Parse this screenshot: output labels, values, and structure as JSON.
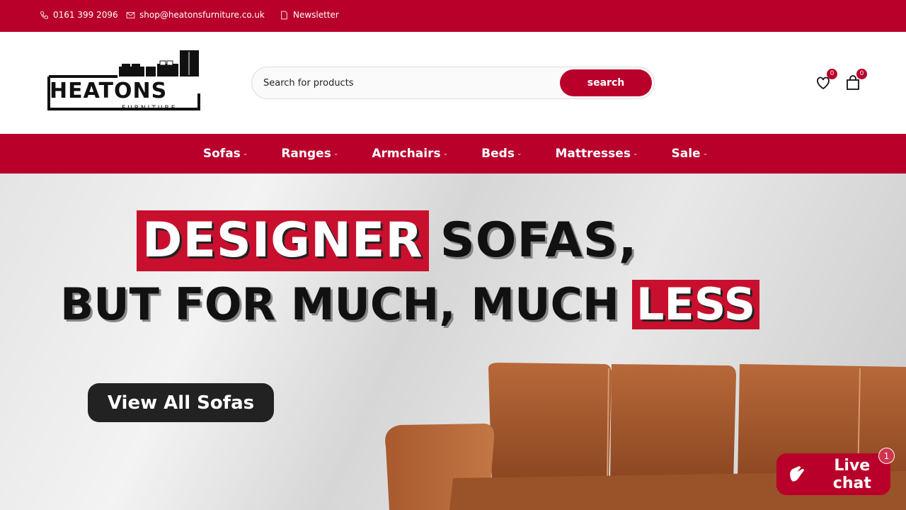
{
  "topbar": {
    "phone": "0161 399 2096",
    "email": "shop@heatonsfurniture.co.uk",
    "newsletter": "Newsletter"
  },
  "logo": {
    "name": "HEATONS",
    "subtitle": "FURNITURE"
  },
  "search": {
    "placeholder": "Search for products",
    "button_label": "search"
  },
  "header_icons": {
    "wishlist_count": "0",
    "cart_count": "0"
  },
  "nav": {
    "items": [
      {
        "label": "Sofas"
      },
      {
        "label": "Ranges"
      },
      {
        "label": "Armchairs"
      },
      {
        "label": "Beds"
      },
      {
        "label": "Mattresses"
      },
      {
        "label": "Sale"
      }
    ]
  },
  "hero": {
    "line1_highlight": "DESIGNER",
    "line1_rest": "SOFAS,",
    "line2_main": "BUT FOR MUCH, MUCH",
    "line2_highlight": "LESS",
    "cta_label": "View All Sofas"
  },
  "chat": {
    "label": "Live chat",
    "badge": "1"
  },
  "colors": {
    "brand": "#b8002b",
    "hero_red": "#c8102e",
    "dark": "#222222"
  },
  "icons": [
    "phone-icon",
    "mail-icon",
    "newsletter-icon",
    "heart-icon",
    "bag-icon",
    "wave-hand-icon"
  ]
}
